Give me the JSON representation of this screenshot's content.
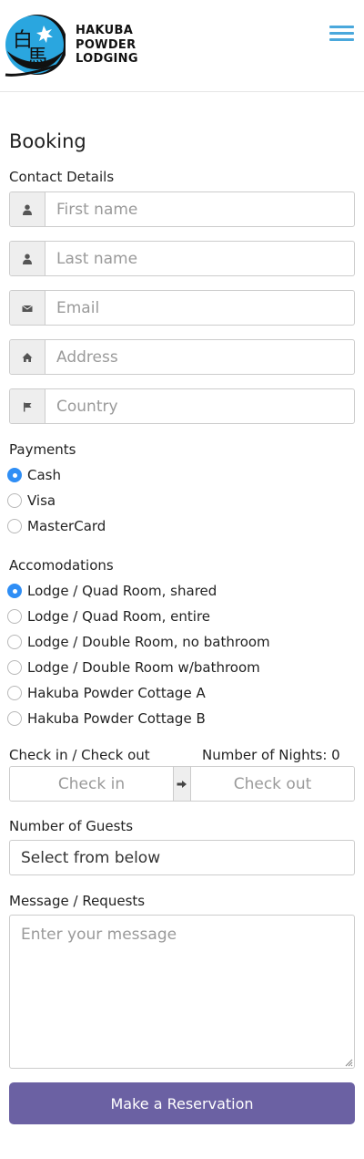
{
  "brand": {
    "line1": "HAKUBA",
    "line2": "POWDER",
    "line3": "LODGING"
  },
  "menu_icon": "hamburger-menu-icon",
  "title": "Booking",
  "contact": {
    "label": "Contact Details",
    "fields": [
      {
        "icon": "user-icon",
        "placeholder": "First name"
      },
      {
        "icon": "user-icon",
        "placeholder": "Last name"
      },
      {
        "icon": "envelope-icon",
        "placeholder": "Email"
      },
      {
        "icon": "home-icon",
        "placeholder": "Address"
      },
      {
        "icon": "flag-icon",
        "placeholder": "Country"
      }
    ]
  },
  "payments": {
    "label": "Payments",
    "options": [
      "Cash",
      "Visa",
      "MasterCard"
    ],
    "selected": "Cash"
  },
  "accommodations": {
    "label": "Accomodations",
    "options": [
      "Lodge / Quad Room, shared",
      "Lodge / Quad Room, entire",
      "Lodge / Double Room, no bathroom",
      "Lodge / Double Room w/bathroom",
      "Hakuba Powder Cottage A",
      "Hakuba Powder Cottage B"
    ],
    "selected": "Lodge / Quad Room, shared"
  },
  "dates": {
    "label": "Check in / Check out",
    "nights_label": "Number of Nights: 0",
    "checkin_placeholder": "Check in",
    "checkout_placeholder": "Check out",
    "arrow_icon": "arrow-right-icon"
  },
  "guests": {
    "label": "Number of Guests",
    "selected": "Select from below"
  },
  "message": {
    "label": "Message / Requests",
    "placeholder": "Enter your message"
  },
  "submit_label": "Make a Reservation",
  "colors": {
    "accent": "#4aa8dc",
    "button": "#6b61a3",
    "radio": "#2f8ef5"
  }
}
